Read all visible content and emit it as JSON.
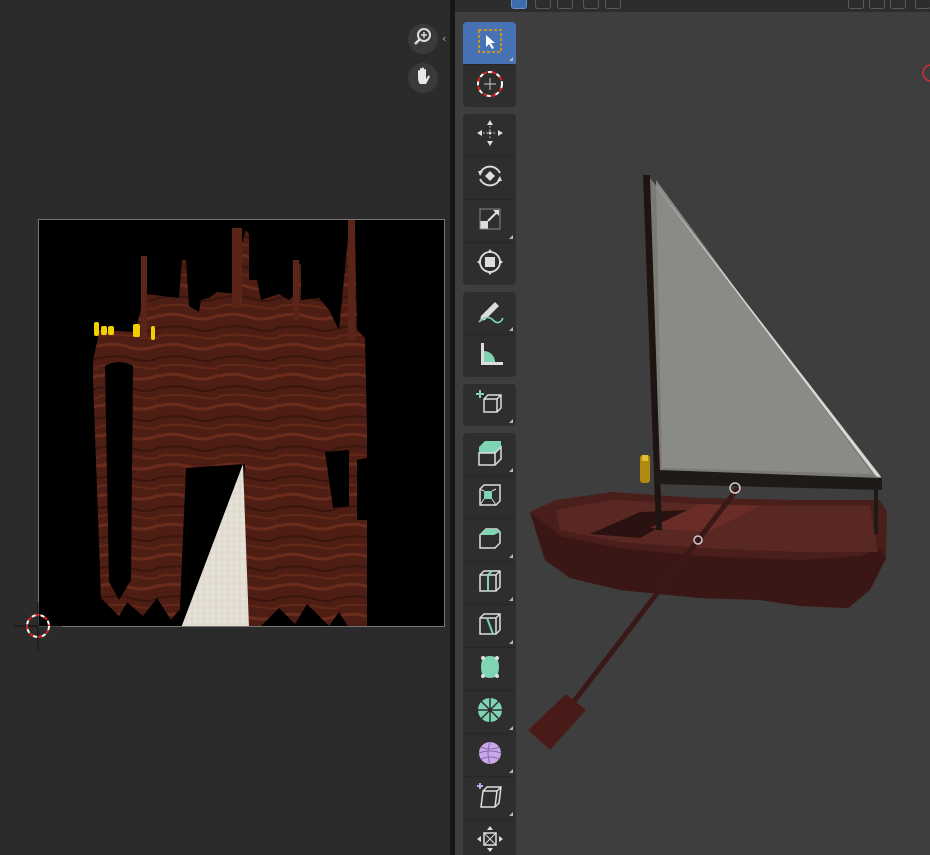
{
  "uv_editor": {
    "zoom_icon": "zoom-in-icon",
    "pan_icon": "hand-pan-icon",
    "collapse_icon": "chevron-left-icon"
  },
  "viewport": {
    "header_right_text": "◯"
  },
  "toolbar": {
    "groups": [
      [
        "select-box-icon",
        "cursor-icon"
      ],
      [
        "move-icon",
        "rotate-icon",
        "scale-icon",
        "transform-icon"
      ],
      [
        "annotate-icon",
        "measure-icon"
      ],
      [
        "add-cube-icon"
      ],
      [
        "extrude-region-icon",
        "inset-faces-icon",
        "bevel-icon",
        "loop-cut-icon",
        "knife-icon",
        "poly-build-icon",
        "spin-icon",
        "smooth-icon",
        "shear-icon",
        "shrink-fatten-icon"
      ]
    ]
  },
  "colors": {
    "accent": "#4772b3",
    "wood": "#5a2418",
    "sail": "#e8e4dc",
    "highlight": "#f0d000"
  }
}
